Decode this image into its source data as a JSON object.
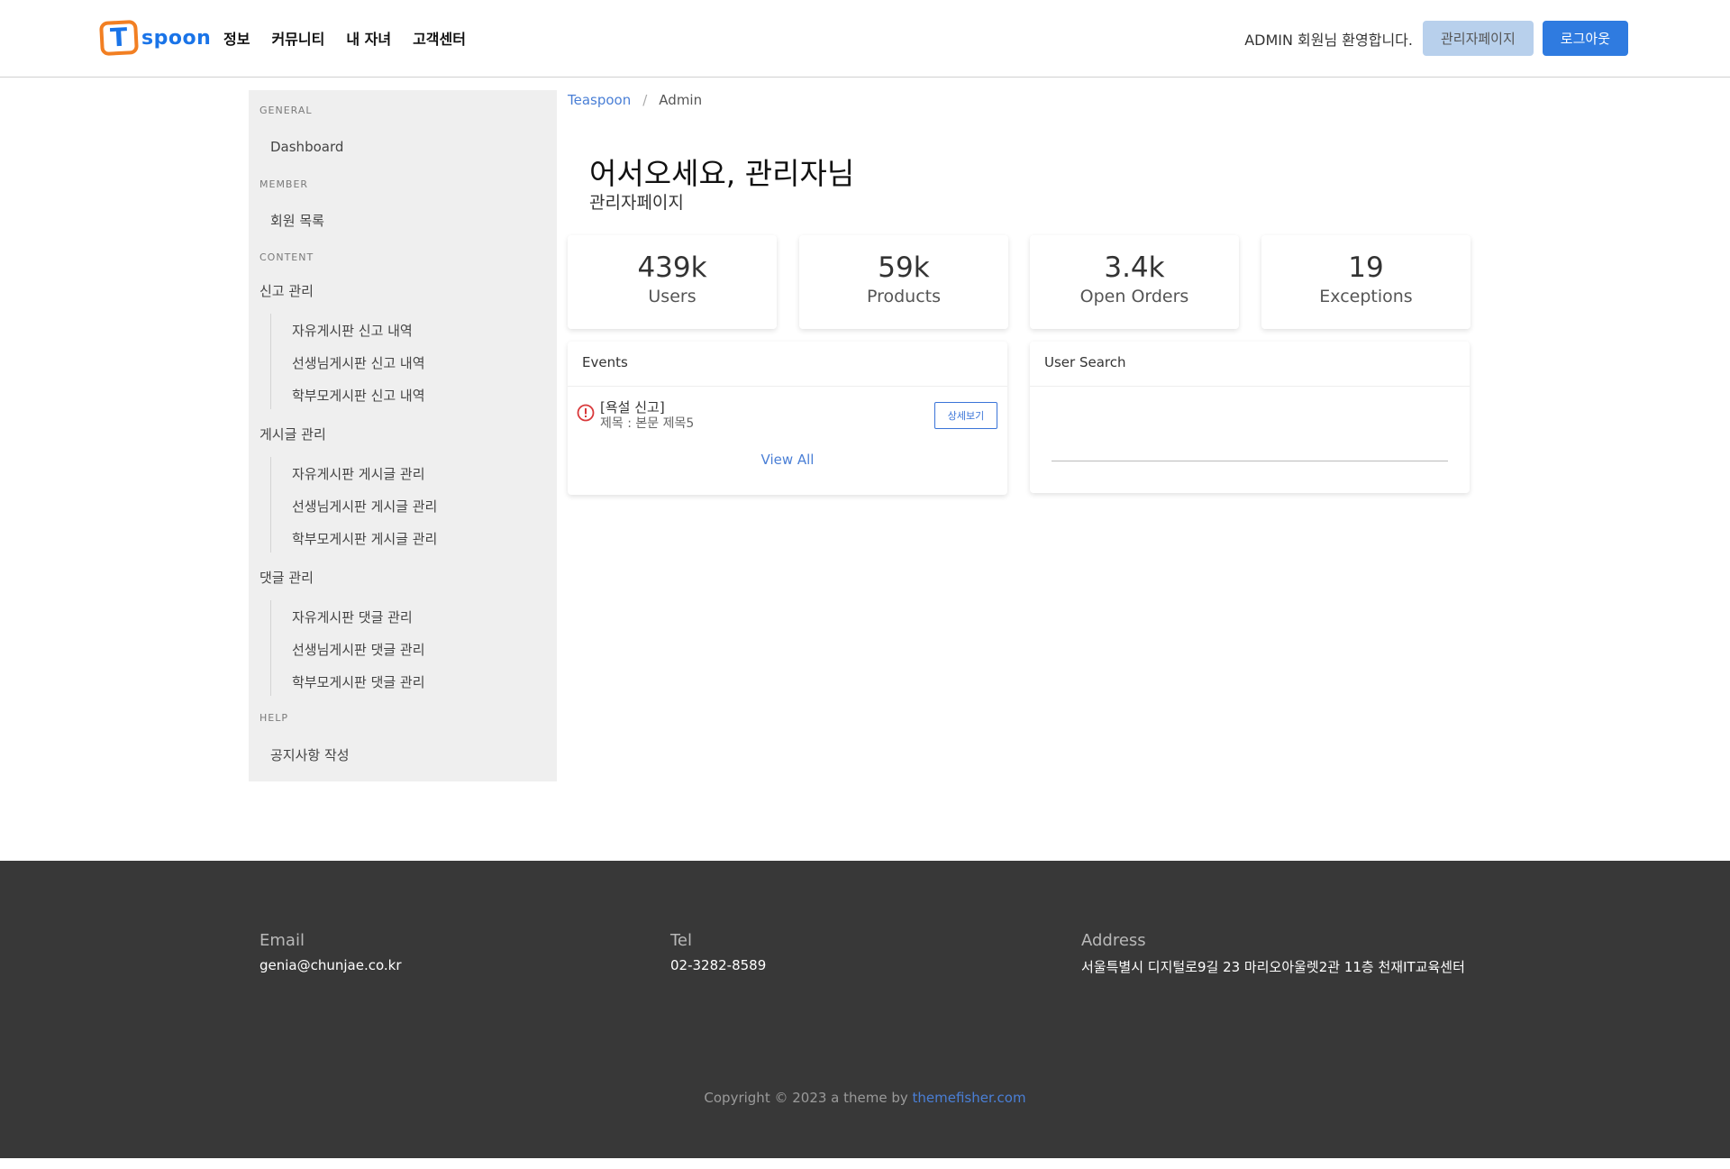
{
  "header": {
    "logo_letter": "T",
    "logo_text": "spoon",
    "nav": [
      "정보",
      "커뮤니티",
      "내 자녀",
      "고객센터"
    ],
    "welcome": "ADMIN 회원님 환영합니다.",
    "admin_button": "관리자페이지",
    "logout_button": "로그아웃",
    "colors": {
      "primary": "#2f7be0",
      "admin_btn": "#b8d0ec",
      "logo_orange": "#f27f22"
    }
  },
  "sidebar": {
    "general_label": "GENERAL",
    "dashboard": "Dashboard",
    "member_label": "MEMBER",
    "member_list": "회원 목록",
    "content_label": "CONTENT",
    "report_group": "신고 관리",
    "report_items": [
      "자유게시판 신고 내역",
      "선생님게시판 신고 내역",
      "학부모게시판 신고 내역"
    ],
    "post_group": "게시글 관리",
    "post_items": [
      "자유게시판 게시글 관리",
      "선생님게시판 게시글 관리",
      "학부모게시판 게시글 관리"
    ],
    "comment_group": "댓글 관리",
    "comment_items": [
      "자유게시판 댓글 관리",
      "선생님게시판 댓글 관리",
      "학부모게시판 댓글 관리"
    ],
    "help_label": "HELP",
    "notice_write": "공지사항 작성"
  },
  "breadcrumb": {
    "home": "Teaspoon",
    "sep": "/",
    "current": "Admin"
  },
  "hero": {
    "title": "어서오세요, 관리자님",
    "subtitle": "관리자페이지"
  },
  "stats": [
    {
      "value": "439k",
      "label": "Users"
    },
    {
      "value": "59k",
      "label": "Products"
    },
    {
      "value": "3.4k",
      "label": "Open Orders"
    },
    {
      "value": "19",
      "label": "Exceptions"
    }
  ],
  "events": {
    "title": "Events",
    "items": [
      {
        "title": "[욕설 신고]",
        "subtitle": "제목 : 본문 제목5",
        "button": "상세보기",
        "icon": "warning-circle-icon"
      }
    ],
    "view_all": "View All"
  },
  "user_search": {
    "title": "User Search",
    "placeholder": ""
  },
  "footer": {
    "email_label": "Email",
    "email": "genia@chunjae.co.kr",
    "tel_label": "Tel",
    "tel": "02-3282-8589",
    "address_label": "Address",
    "address": "서울특별시 디지털로9길 23 마리오아울렛2관 11층 천재IT교육센터",
    "copyright_prefix": "Copyright © 2023 a theme by ",
    "copyright_brand": "themefisher.com"
  }
}
